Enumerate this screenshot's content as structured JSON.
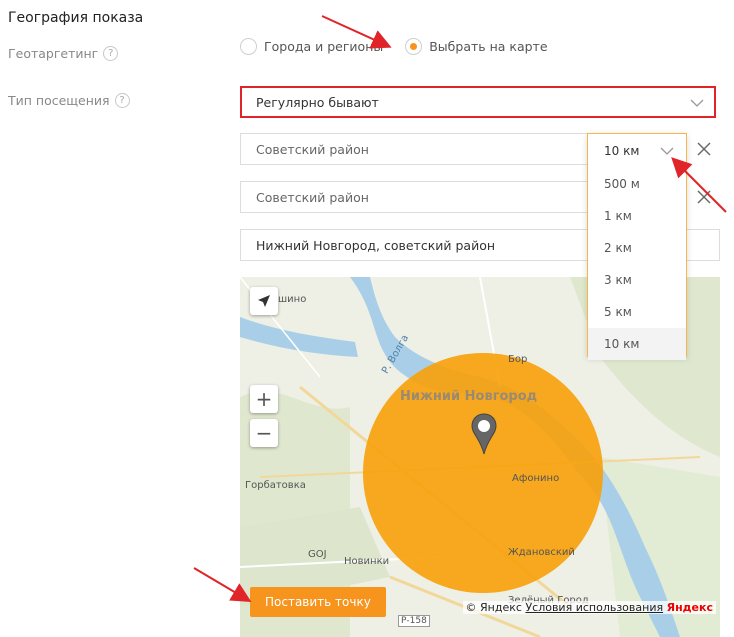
{
  "section": {
    "title": "География показа"
  },
  "geotargeting": {
    "label": "Геотаргетинг",
    "options": [
      {
        "label": "Города и регионы",
        "checked": false
      },
      {
        "label": "Выбрать на карте",
        "checked": true
      }
    ]
  },
  "visit_type": {
    "label": "Тип посещения",
    "value": "Регулярно бывают"
  },
  "locations": [
    {
      "value": "Советский район"
    },
    {
      "value": "Советский район"
    },
    {
      "value": "Нижний Новгород, советский район"
    }
  ],
  "radius_dropdown": {
    "current": "10 км",
    "options": [
      "500 м",
      "1 км",
      "2 км",
      "3 км",
      "5 км",
      "10 км"
    ],
    "selected_index": 5
  },
  "help_glyph": "?",
  "map": {
    "city_label": "Нижний Новгород",
    "labels": [
      "шино",
      "Бор",
      "Горбатовка",
      "Афонино",
      "GOJ",
      "Новинки",
      "Ждановский",
      "Зелёный Город",
      "Р-158",
      "Р. Волга"
    ],
    "zoom_in": "+",
    "zoom_out": "−",
    "place_point_button": "Поставить точку",
    "copyright": "© Яндекс",
    "terms": "Условия использования",
    "brand": "Яндекс",
    "accent_color": "#f7941d"
  }
}
